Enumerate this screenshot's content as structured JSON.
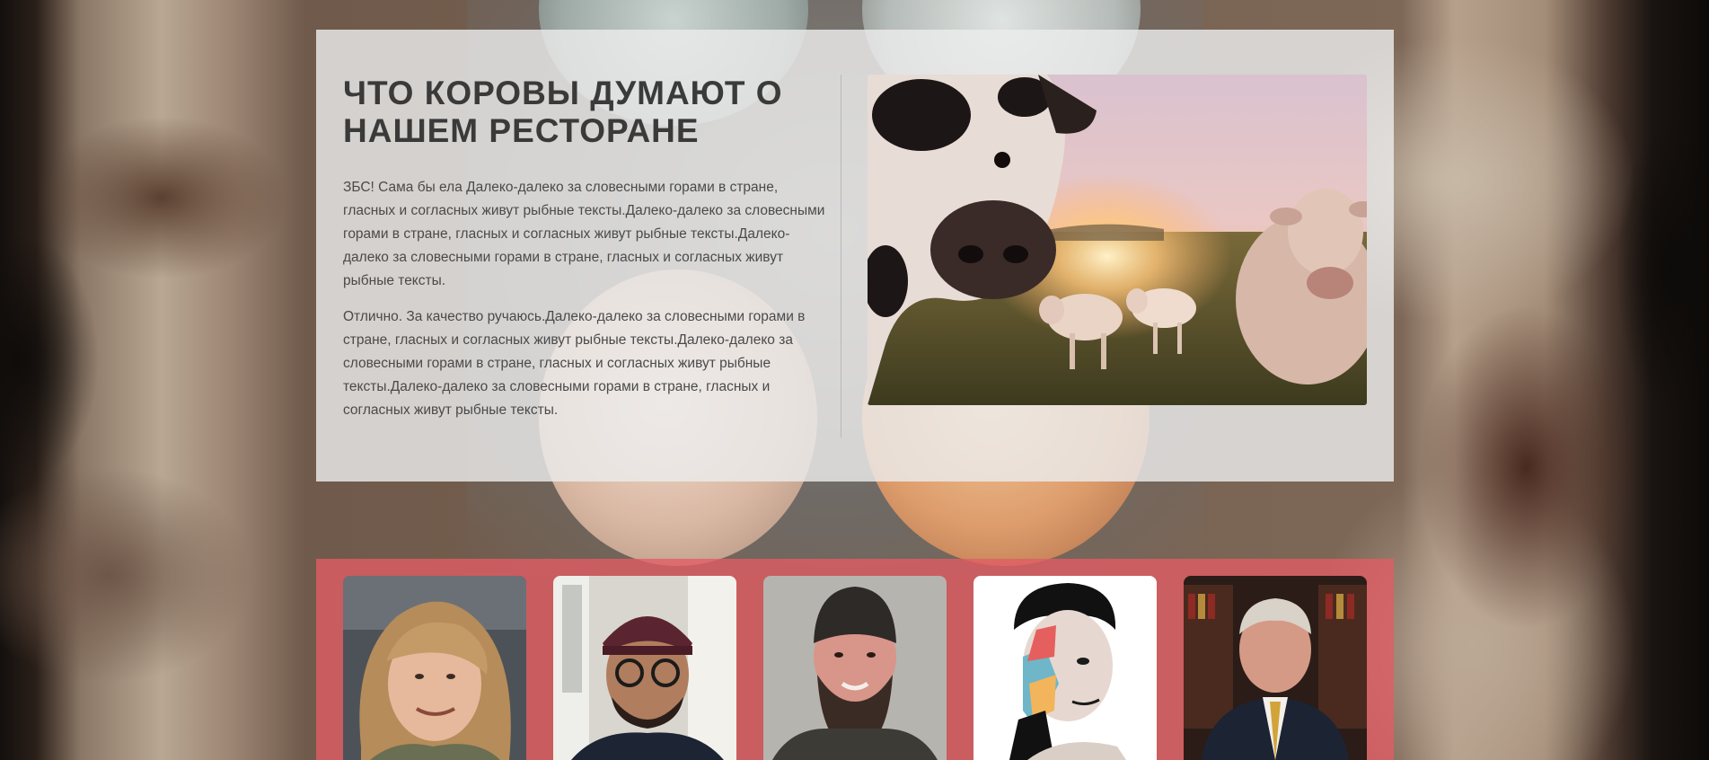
{
  "section": {
    "title": "ЧТО КОРОВЫ ДУМАЮТ О НАШЕМ РЕСТОРАНЕ",
    "paragraphs": [
      "ЗБС! Сама бы ела Далеко-далеко за словесными горами в стране, гласных и согласных живут рыбные тексты.Далеко-далеко за словесными горами в стране, гласных и согласных живут рыбные тексты.Далеко-далеко за словесными горами в стране, гласных и согласных живут рыбные тексты.",
      "Отлично. За качество ручаюсь.Далеко-далеко за словесными горами в стране, гласных и согласных живут рыбные тексты.Далеко-далеко за словесными горами в стране, гласных и согласных живут рыбные тексты.Далеко-далеко за словесными горами в стране, гласных и согласных живут рыбные тексты."
    ]
  },
  "team": {
    "accent_color": "#e15c64",
    "members": [
      {
        "photo": "woman-curly-hair-portrait"
      },
      {
        "photo": "man-cap-glasses-portrait"
      },
      {
        "photo": "bearded-man-beanie-portrait"
      },
      {
        "photo": "artistic-painted-face-portrait"
      },
      {
        "photo": "man-suit-tie-portrait"
      }
    ]
  }
}
